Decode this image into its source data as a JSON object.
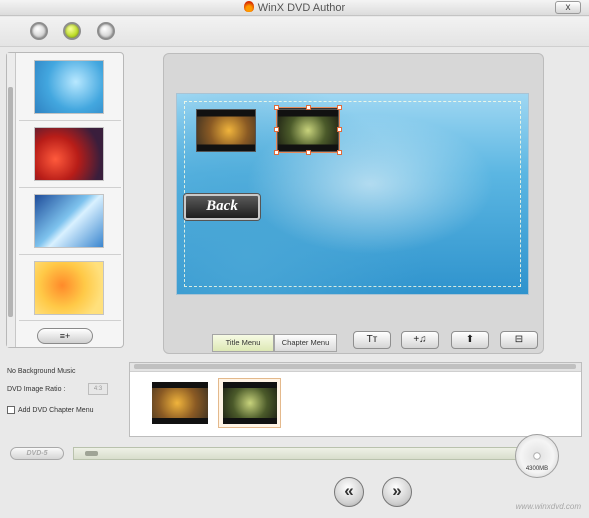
{
  "window": {
    "title": "WinX DVD Author",
    "close_label": "x"
  },
  "toolbar": {
    "buttons": [
      {
        "name": "step-1",
        "state": "inactive"
      },
      {
        "name": "step-2",
        "state": "active"
      },
      {
        "name": "step-3",
        "state": "inactive"
      }
    ]
  },
  "background_panel": {
    "add_button_label": "≡+",
    "thumbnails": [
      "blue-mosaic",
      "red-flowers",
      "blue-light-streak",
      "yellow-orange-flowers"
    ]
  },
  "preview": {
    "back_button_label": "Back",
    "menu_items": [
      "title-thumbnail-1",
      "title-thumbnail-2"
    ]
  },
  "menu_tabs": {
    "title_menu": "Title Menu",
    "chapter_menu": "Chapter Menu",
    "active": "Title Menu"
  },
  "tools": {
    "text_label": "Tт",
    "music_label": "+♫",
    "upload_label": "⬆",
    "ratio_label": "⊟"
  },
  "settings": {
    "background_music": "No Background Music",
    "image_ratio_label": "DVD Image Ratio :",
    "image_ratio_value": "4:3",
    "chapter_menu_label": "Add DVD Chapter Menu",
    "chapter_menu_checked": false
  },
  "disc": {
    "type_label": "DVD-5",
    "capacity_label": "4300MB",
    "used_fraction": 0.03
  },
  "navigation": {
    "back_label": "«",
    "next_label": "»"
  },
  "watermark": "www.winxdvd.com",
  "colors": {
    "active_circle": "#b6d81a",
    "selection_handle": "#e06a3a",
    "canvas_blue": "#5bb6e2"
  }
}
